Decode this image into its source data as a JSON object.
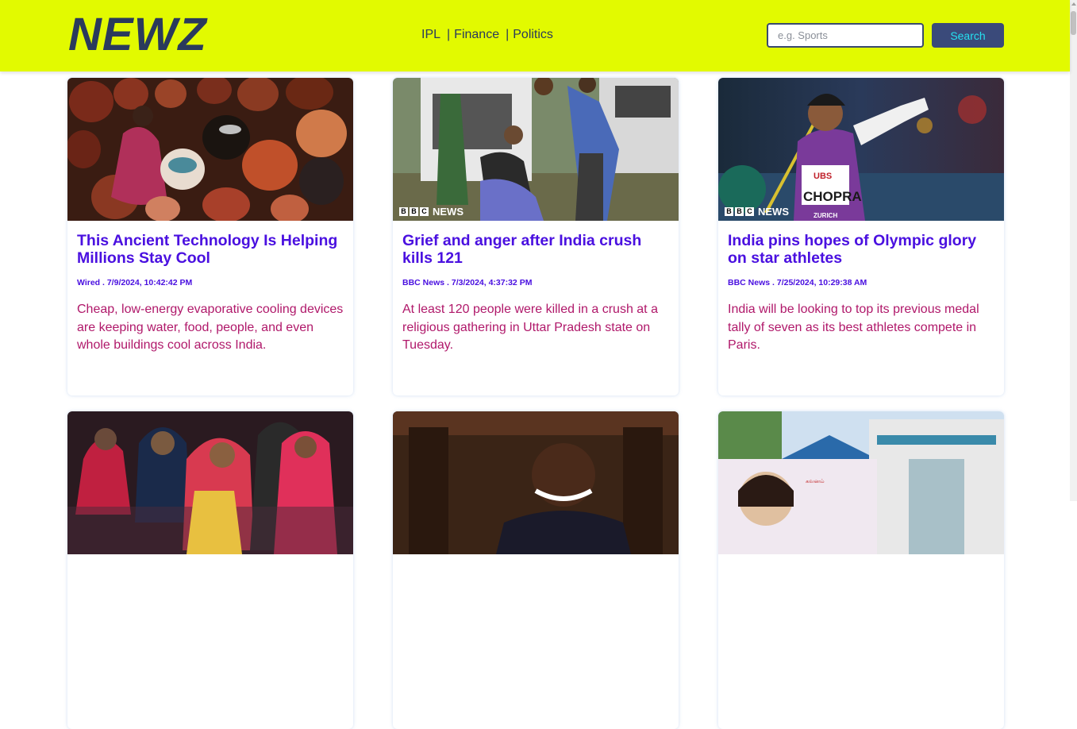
{
  "header": {
    "logo": "NEWZ",
    "nav": [
      "IPL",
      "Finance",
      "Politics"
    ],
    "search_placeholder": "e.g. Sports",
    "search_label": "Search"
  },
  "articles": [
    {
      "title": "This Ancient Technology Is Helping Millions Stay Cool",
      "source": "Wired",
      "date": "7/9/2024, 10:42:42 PM",
      "description": "Cheap, low-energy evaporative cooling devices are keeping water, food, people, and even whole buildings cool across India."
    },
    {
      "title": "Grief and anger after India crush kills 121",
      "source": "BBC News",
      "date": "7/3/2024, 4:37:32 PM",
      "description": "At least 120 people were killed in a crush at a religious gathering in Uttar Pradesh state on Tuesday.",
      "image_watermark": "NEWS"
    },
    {
      "title": "India pins hopes of Olympic glory on star athletes",
      "source": "BBC News",
      "date": "7/25/2024, 10:29:38 AM",
      "description": "India will be looking to top its previous medal tally of seven as its best athletes compete in Paris.",
      "image_watermark": "NEWS",
      "image_text": [
        "UBS",
        "CHOPRA",
        "ZURICH"
      ]
    }
  ],
  "colors": {
    "header_bg": "#e2fa00",
    "logo": "#2a3a5c",
    "title": "#4a10e0",
    "description": "#b0186a",
    "button_bg": "#3a4a7a",
    "button_text": "#25e0ef"
  }
}
